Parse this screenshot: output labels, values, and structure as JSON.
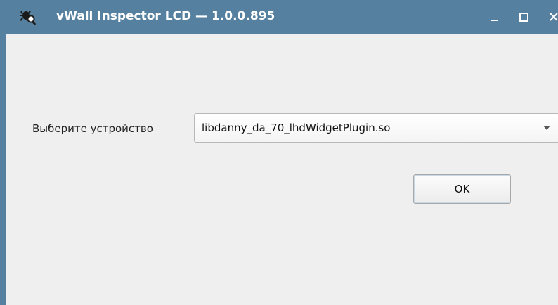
{
  "window": {
    "title": "vWall Inspector LCD — 1.0.0.895",
    "app_icon": "bug-magnifier-icon",
    "controls": {
      "minimize_icon": "minimize-icon",
      "maximize_icon": "maximize-icon",
      "close_icon": "close-icon"
    },
    "titlebar_color": "#56809f"
  },
  "form": {
    "device_label": "Выберите устройство",
    "device_select": {
      "selected": "libdanny_da_70_lhdWidgetPlugin.so",
      "arrow_icon": "chevron-down-icon"
    },
    "ok_label": "OK"
  }
}
